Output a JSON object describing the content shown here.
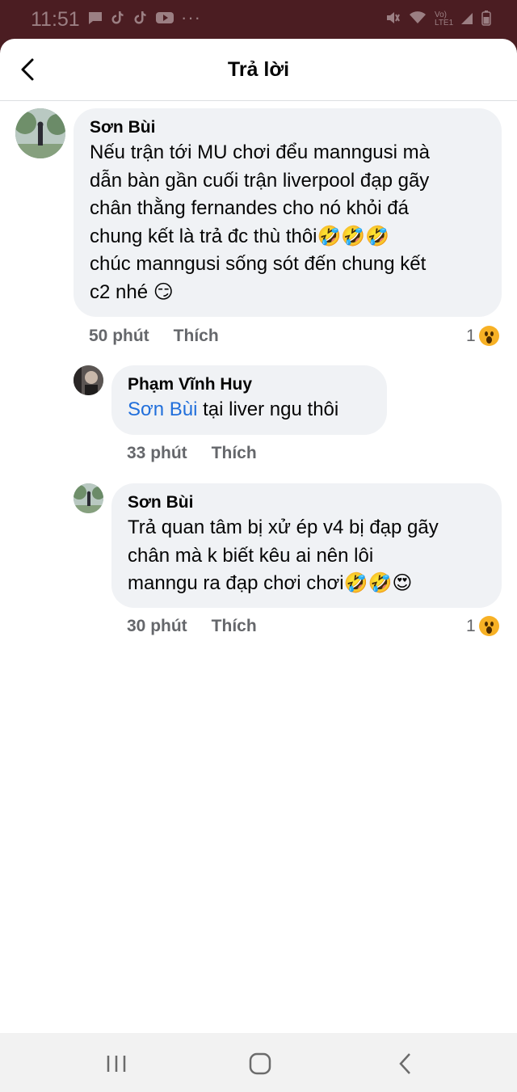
{
  "status_bar": {
    "time": "11:51",
    "dots": "···",
    "net_label": "Vo) LTE1"
  },
  "header": {
    "title": "Trả lời"
  },
  "comments": [
    {
      "author": "Sơn Bùi",
      "text": "Nếu trận tới MU chơi đểu  manngusi  mà\ndẫn bàn gần cuối trận liverpool đạp gãy\nchân thằng fernandes cho nó khỏi đá\nchung kết là trả đc thù thôi🤣🤣🤣\nchúc manngusi sống sót đến chung kết\nc2 nhé 😏",
      "time": "50 phút",
      "like": "Thích",
      "reactions": "1"
    },
    {
      "author": "Phạm Vĩnh Huy",
      "mention": "Sơn Bùi",
      "text": " tại liver ngu thôi",
      "time": "33 phút",
      "like": "Thích"
    },
    {
      "author": "Sơn Bùi",
      "text": "Trả quan tâm bị xử ép v4 bị đạp gãy\nchân mà k biết kêu ai nên lôi\nmanngu ra đạp chơi chơi🤣🤣😍",
      "time": "30 phút",
      "like": "Thích",
      "reactions": "1"
    }
  ],
  "icons": {
    "back": "chevron-left-icon",
    "reaction": "wow-reaction-icon",
    "nav_recent": "recent-apps-icon",
    "nav_home": "home-icon",
    "nav_back": "back-icon"
  }
}
